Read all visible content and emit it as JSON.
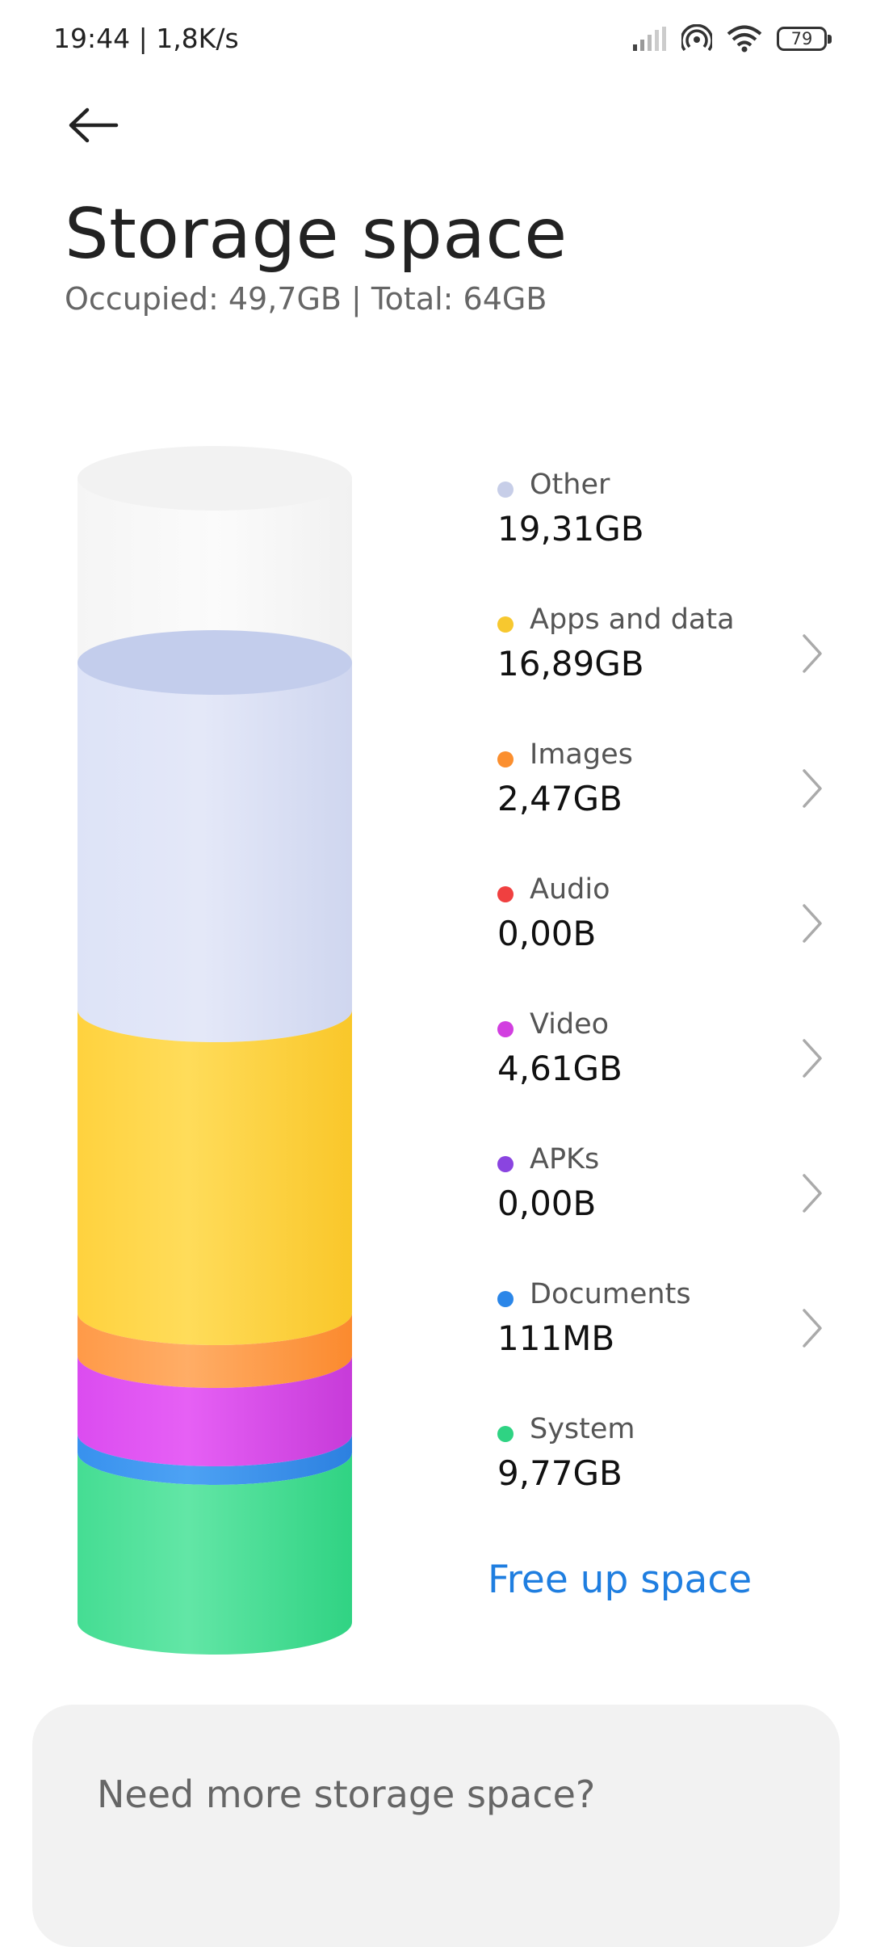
{
  "status_bar": {
    "time_speed": "19:44 | 1,8K/s",
    "battery": "79",
    "icons": [
      "signal-icon",
      "hotspot-icon",
      "wifi-icon",
      "battery-icon"
    ]
  },
  "header": {
    "back_icon": "back-arrow-icon",
    "title": "Storage space",
    "subtitle": "Occupied: 49,7GB | Total: 64GB"
  },
  "categories": [
    {
      "name": "Other",
      "size": "19,31GB",
      "color": "#c7cee8",
      "chevron": false
    },
    {
      "name": "Apps and data",
      "size": "16,89GB",
      "color": "#f7c82f",
      "chevron": true
    },
    {
      "name": "Images",
      "size": "2,47GB",
      "color": "#fb8f2f",
      "chevron": true
    },
    {
      "name": "Audio",
      "size": "0,00B",
      "color": "#f04040",
      "chevron": true
    },
    {
      "name": "Video",
      "size": "4,61GB",
      "color": "#d23fe0",
      "chevron": true
    },
    {
      "name": "APKs",
      "size": "0,00B",
      "color": "#8a44e0",
      "chevron": true
    },
    {
      "name": "Documents",
      "size": "111MB",
      "color": "#2b86e8",
      "chevron": true
    },
    {
      "name": "System",
      "size": "9,77GB",
      "color": "#2fd383",
      "chevron": false
    }
  ],
  "actions": {
    "free_up": "Free up space"
  },
  "promo": {
    "title": "Need more storage space?"
  },
  "colors": {
    "accent": "#1f7ee0",
    "free_space": "#f4f4f4",
    "card_bg": "#f2f2f2"
  }
}
